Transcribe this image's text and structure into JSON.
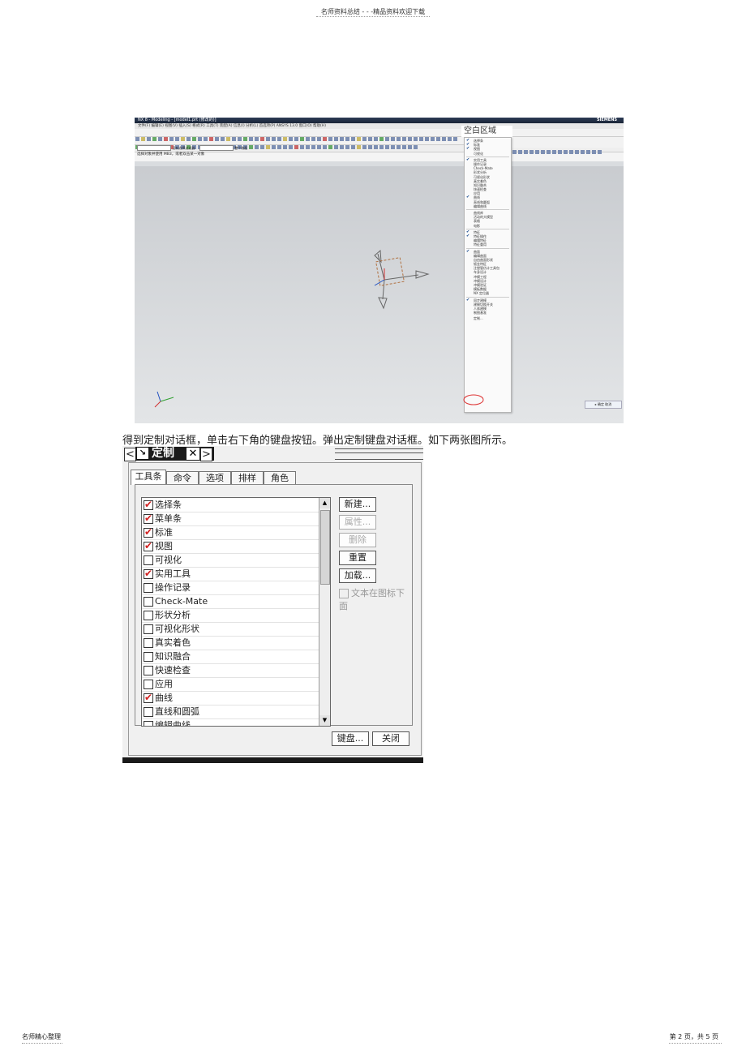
{
  "page_header": {
    "text": "名师资料总结 - - -精品资料欢迎下载"
  },
  "page_footer": {
    "left": "名师精心整理",
    "right": "第 2 页，共 5 页"
  },
  "nx_window": {
    "title": "NX 8 - Modeling - [model1.prt (修改的)]",
    "brand": "SIEMENS",
    "menu": "文件(F)  编辑(E)  视图(V)  插入(S)  格式(R)  工具(T)  装配(A)  信息(I)  分析(L)  首选项(P)  ANSYS 13.0  窗口(O)  帮助(H)",
    "selection_filter": "没有选择过滤器",
    "assembly": "整个装配",
    "status": "选择对象并使用 MB3，或者双击某一对象",
    "popup_title": "空白区域",
    "menu_items": [
      {
        "label": "选择条",
        "checked": true
      },
      {
        "label": "标准",
        "checked": true
      },
      {
        "label": "视图",
        "checked": true
      },
      {
        "label": "可视化",
        "checked": false
      },
      {
        "label": "实用工具",
        "checked": true
      },
      {
        "label": "操作记录",
        "checked": false
      },
      {
        "label": "Check-Mate",
        "checked": false
      },
      {
        "label": "形状分析",
        "checked": false
      },
      {
        "label": "可视化形状",
        "checked": false
      },
      {
        "label": "真实着色",
        "checked": false
      },
      {
        "label": "知识融合",
        "checked": false
      },
      {
        "label": "快速检查",
        "checked": false
      },
      {
        "label": "应用",
        "checked": false
      },
      {
        "label": "曲线",
        "checked": true
      },
      {
        "label": "直线和圆弧",
        "checked": false
      },
      {
        "label": "编辑曲线",
        "checked": false
      },
      {
        "label": "曲线库",
        "checked": false
      },
      {
        "label": "活动的大模型",
        "checked": false
      },
      {
        "label": "表格",
        "checked": false
      },
      {
        "label": "电影",
        "checked": false
      },
      {
        "label": "特征",
        "checked": true
      },
      {
        "label": "特征操作",
        "checked": true
      },
      {
        "label": "编辑特征",
        "checked": false
      },
      {
        "label": "特征重用",
        "checked": false
      },
      {
        "label": "曲面",
        "checked": true
      },
      {
        "label": "编辑曲面",
        "checked": false
      },
      {
        "label": "自由曲面形状",
        "checked": false
      },
      {
        "label": "钣金特征",
        "checked": false
      },
      {
        "label": "注塑管仿计工具包",
        "checked": false
      },
      {
        "label": "车身设计",
        "checked": false
      },
      {
        "label": "冲模工程",
        "checked": false
      },
      {
        "label": "冲模设计",
        "checked": false
      },
      {
        "label": "冲模验证",
        "checked": false
      },
      {
        "label": "模板数据",
        "checked": false
      },
      {
        "label": "NX 定位器",
        "checked": false
      },
      {
        "label": "同步建模",
        "checked": true
      },
      {
        "label": "建模切换开关",
        "checked": false
      },
      {
        "label": "人体建模",
        "checked": false
      },
      {
        "label": "制图基准",
        "checked": false
      }
    ],
    "customize_item": "定制...",
    "bottom_right": "▸ 确定   取消"
  },
  "paragraph": "得到定制对话框，单击右下角的键盘按钮。弹出定制键盘对话框。如下两张图所示。",
  "dialog": {
    "title": "定制",
    "tabs": [
      "工具条",
      "命令",
      "选项",
      "排样",
      "角色"
    ],
    "active_tab": 0,
    "toolbars": [
      {
        "label": "选择条",
        "checked": true
      },
      {
        "label": "菜单条",
        "checked": true
      },
      {
        "label": "标准",
        "checked": true
      },
      {
        "label": "视图",
        "checked": true
      },
      {
        "label": "可视化",
        "checked": false
      },
      {
        "label": "实用工具",
        "checked": true
      },
      {
        "label": "操作记录",
        "checked": false
      },
      {
        "label": "Check-Mate",
        "checked": false
      },
      {
        "label": "形状分析",
        "checked": false
      },
      {
        "label": "可视化形状",
        "checked": false
      },
      {
        "label": "真实着色",
        "checked": false
      },
      {
        "label": "知识融合",
        "checked": false
      },
      {
        "label": "快速检查",
        "checked": false
      },
      {
        "label": "应用",
        "checked": false
      },
      {
        "label": "曲线",
        "checked": true
      },
      {
        "label": "直线和圆弧",
        "checked": false
      },
      {
        "label": "编辑曲线",
        "checked": false
      }
    ],
    "buttons": {
      "new": "新建...",
      "properties": "属性...",
      "delete": "删除",
      "reset": "重置",
      "load": "加载..."
    },
    "text_below_icon": "文本在图标下面",
    "keyboard": "键盘...",
    "close": "关闭"
  }
}
